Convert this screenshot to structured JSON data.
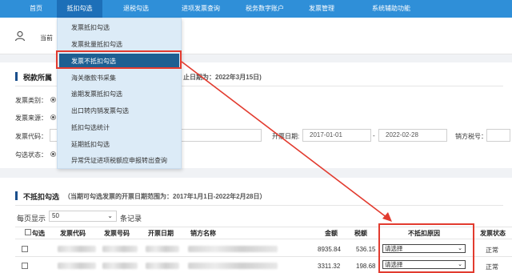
{
  "nav": {
    "items": [
      "首页",
      "抵扣勾选",
      "退税勾选",
      "进项发票查询",
      "税务数字账户",
      "发票管理",
      "系统辅助功能"
    ]
  },
  "user": {
    "label": "当前"
  },
  "dropdown": {
    "items": [
      "发票抵扣勾选",
      "发票批量抵扣勾选",
      "发票不抵扣勾选",
      "海关缴款书采集",
      "逾期发票抵扣勾选",
      "出口转内销发票勾选",
      "抵扣勾选统计",
      "延期抵扣勾选",
      "异常凭证进项税额应申报转出查询"
    ],
    "selected_index": 2
  },
  "section1": {
    "title": "税款所属",
    "note": "止日期为：2022年3月15日)"
  },
  "form": {
    "invoice_type_label": "发票类别：",
    "invoice_source_label": "发票来源：",
    "invoice_code_label": "发票代码：",
    "open_date_label": "开票日期:",
    "date_from": "2017-01-01",
    "date_sep": "-",
    "date_to": "2022-02-28",
    "seller_tax_label": "销方税号：",
    "check_status_label": "勾选状态："
  },
  "section2": {
    "title": "不抵扣勾选",
    "note": "（当期可勾选发票的开票日期范围为：2017年1月1日-2022年2月28日）"
  },
  "pager": {
    "prefix": "每页显示",
    "size": "50",
    "suffix": "条记录"
  },
  "table": {
    "headers": [
      "勾选",
      "发票代码",
      "发票号码",
      "开票日期",
      "销方名称",
      "金额",
      "税额",
      "不抵扣原因",
      "发票状态"
    ],
    "rows": [
      {
        "amount": "8935.84",
        "tax": "536.15",
        "reason": "请选择",
        "status": "正常"
      },
      {
        "amount": "3311.32",
        "tax": "198.68",
        "reason": "请选择",
        "status": "正常"
      }
    ]
  },
  "colors": {
    "nav_bg": "#2f8fd8",
    "nav_active": "#1d6fb8",
    "dropdown_bg": "#dcebf7",
    "selected_item": "#1d5f92",
    "highlight": "#e23b2f"
  }
}
